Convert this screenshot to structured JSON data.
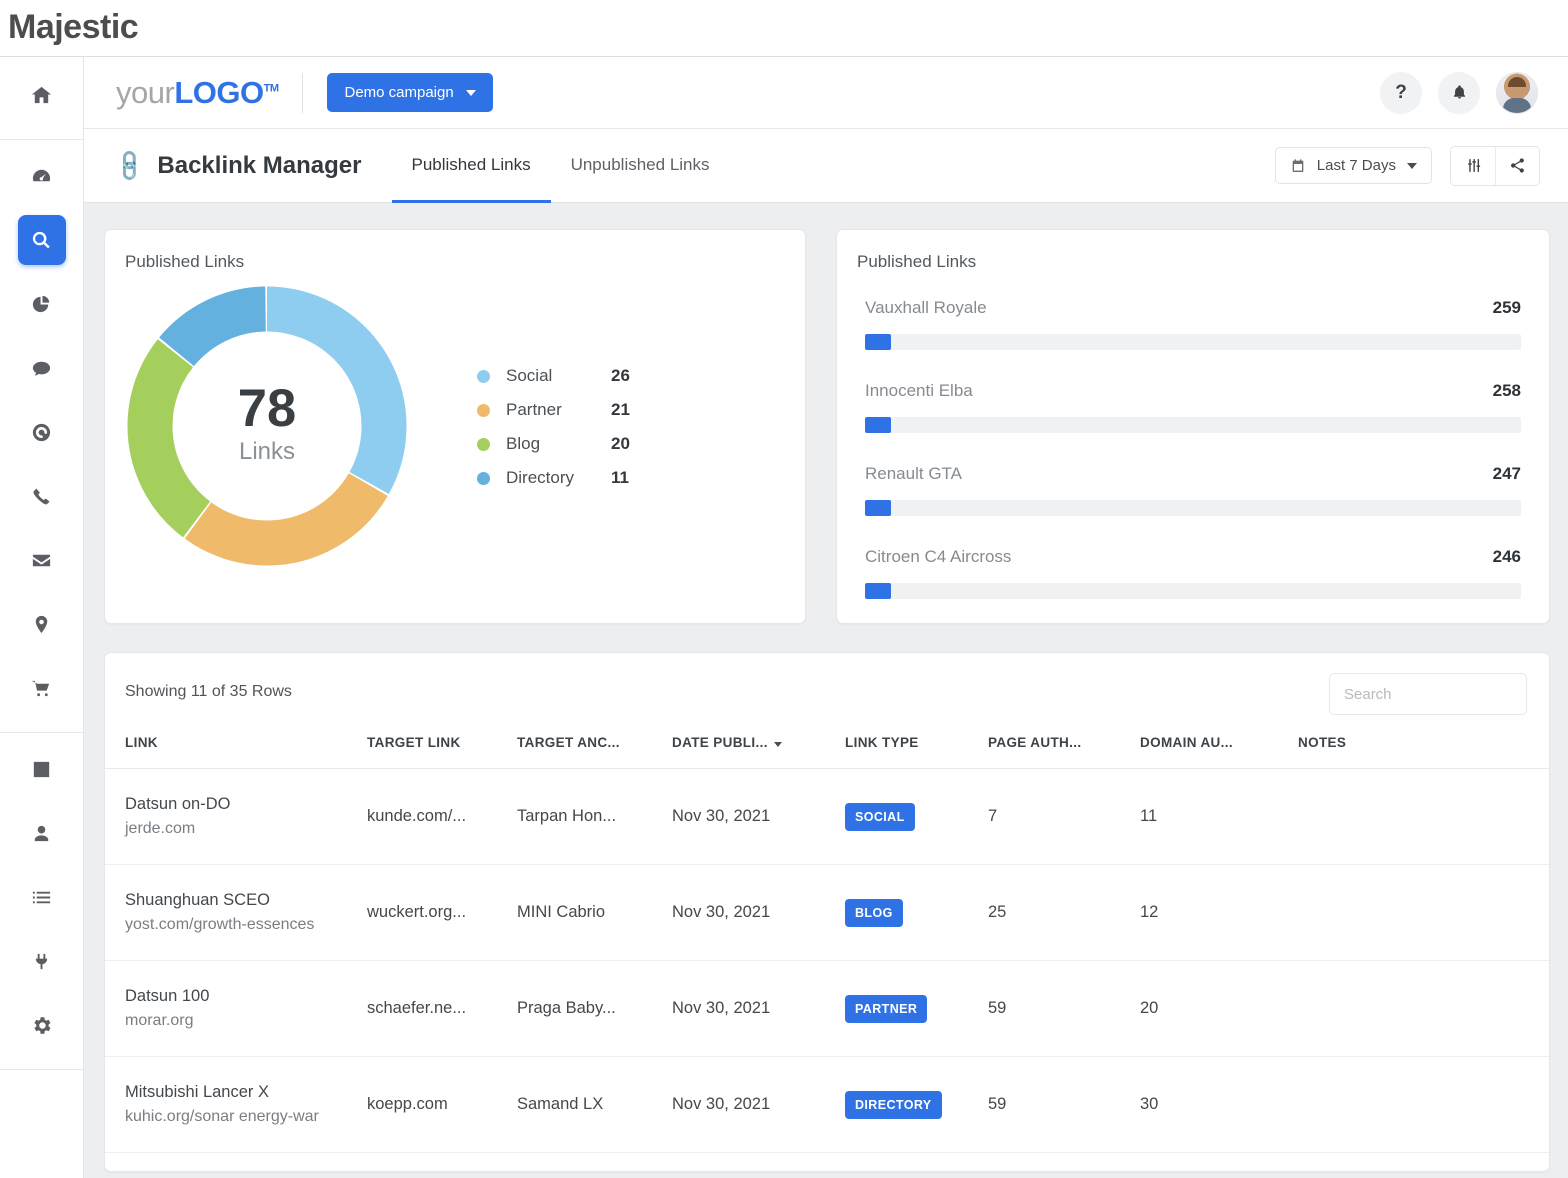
{
  "page_title": "Majestic",
  "topbar": {
    "logo_light": "your",
    "logo_bold": "LOGO",
    "logo_tm": "TM",
    "campaign_label": "Demo campaign",
    "help_label": "?",
    "icons": {
      "help": "help-icon",
      "bell": "bell-icon",
      "avatar": "user-avatar"
    }
  },
  "subheader": {
    "module_icon": "link-icon",
    "module_title": "Backlink Manager",
    "tabs": [
      {
        "label": "Published Links",
        "active": true
      },
      {
        "label": "Unpublished Links",
        "active": false
      }
    ],
    "date_range": "Last 7 Days",
    "tools": [
      "sliders-icon",
      "share-icon"
    ]
  },
  "sidebar": {
    "items": [
      {
        "name": "home",
        "active": false
      },
      {
        "name": "dashboard",
        "active": false
      },
      {
        "name": "search",
        "active": true
      },
      {
        "name": "analytics",
        "active": false
      },
      {
        "name": "chat",
        "active": false
      },
      {
        "name": "campaign",
        "active": false
      },
      {
        "name": "phone",
        "active": false
      },
      {
        "name": "email",
        "active": false
      },
      {
        "name": "location",
        "active": false
      },
      {
        "name": "cart",
        "active": false
      },
      {
        "name": "reports",
        "active": false
      },
      {
        "name": "contacts",
        "active": false
      },
      {
        "name": "tasks",
        "active": false
      },
      {
        "name": "integrations",
        "active": false
      },
      {
        "name": "settings",
        "active": false
      }
    ]
  },
  "donut_card": {
    "title": "Published Links"
  },
  "bars_card": {
    "title": "Published Links",
    "items": [
      {
        "name": "Vauxhall Royale",
        "value": "259",
        "pct": 4.0
      },
      {
        "name": "Innocenti Elba",
        "value": "258",
        "pct": 4.0
      },
      {
        "name": "Renault GTA",
        "value": "247",
        "pct": 4.0
      },
      {
        "name": "Citroen C4 Aircross",
        "value": "246",
        "pct": 4.0
      }
    ]
  },
  "chart_data": {
    "type": "pie",
    "title": "Published Links",
    "center_value": "78",
    "center_label": "Links",
    "categories": [
      "Social",
      "Partner",
      "Blog",
      "Directory"
    ],
    "values": [
      26,
      21,
      20,
      11
    ],
    "colors": [
      "#8ecdf0",
      "#efbb6b",
      "#a5cf5d",
      "#64b0de"
    ],
    "legend_position": "right",
    "grid": false,
    "total": 78
  },
  "table": {
    "showing": "Showing 11 of 35 Rows",
    "search_placeholder": "Search",
    "columns": [
      {
        "label": "LINK",
        "sorted": false
      },
      {
        "label": "TARGET LINK",
        "sorted": false
      },
      {
        "label": "TARGET ANC...",
        "sorted": false
      },
      {
        "label": "DATE PUBLI...",
        "sorted": true
      },
      {
        "label": "LINK TYPE",
        "sorted": false
      },
      {
        "label": "PAGE AUTH...",
        "sorted": false
      },
      {
        "label": "DOMAIN AU...",
        "sorted": false
      },
      {
        "label": "NOTES",
        "sorted": false
      }
    ],
    "rows": [
      {
        "link_title": "Datsun on-DO",
        "link_sub": "jerde.com",
        "target_link": "kunde.com/...",
        "target_anchor": "Tarpan Hon...",
        "date": "Nov 30, 2021",
        "link_type": "SOCIAL",
        "page_authority": "7",
        "domain_authority": "11",
        "notes": ""
      },
      {
        "link_title": "Shuanghuan SCEO",
        "link_sub": "yost.com/growth-essences",
        "target_link": "wuckert.org...",
        "target_anchor": "MINI Cabrio",
        "date": "Nov 30, 2021",
        "link_type": "BLOG",
        "page_authority": "25",
        "domain_authority": "12",
        "notes": ""
      },
      {
        "link_title": "Datsun 100",
        "link_sub": "morar.org",
        "target_link": "schaefer.ne...",
        "target_anchor": "Praga Baby...",
        "date": "Nov 30, 2021",
        "link_type": "PARTNER",
        "page_authority": "59",
        "domain_authority": "20",
        "notes": ""
      },
      {
        "link_title": "Mitsubishi Lancer X",
        "link_sub": "kuhic.org/sonar energy-war",
        "target_link": "koepp.com",
        "target_anchor": "Samand LX",
        "date": "Nov 30, 2021",
        "link_type": "DIRECTORY",
        "page_authority": "59",
        "domain_authority": "30",
        "notes": ""
      }
    ]
  },
  "theme": {
    "accent": "#2f72e6",
    "page_bg": "#eceef0",
    "card_bg": "#ffffff"
  }
}
